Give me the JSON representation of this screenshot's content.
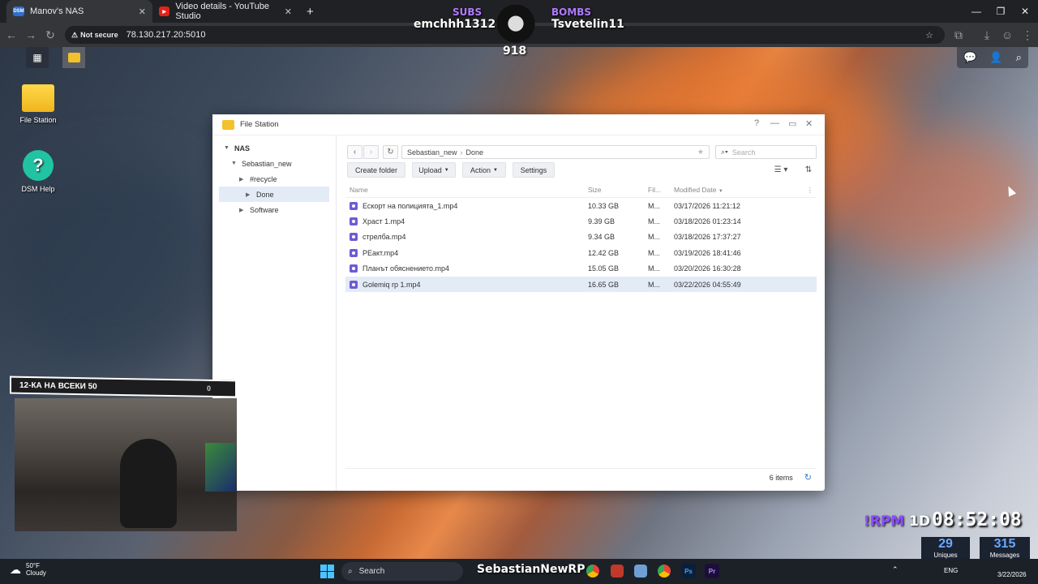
{
  "browser": {
    "tabs": [
      {
        "label": "Manov's NAS",
        "active": true,
        "icon": "dsm-icon"
      },
      {
        "label": "Video details - YouTube Studio",
        "active": false,
        "icon": "youtube-icon"
      }
    ],
    "not_secure": "Not secure",
    "url": "78.130.217.20:5010"
  },
  "overlay": {
    "subs_label": "SUBS",
    "subs_user": "emchhh1312",
    "bombs_label": "BOMBS",
    "bombs_user": "Tsvetelin11",
    "counter": "918",
    "cam_label": "12-КА НА ВСЕКИ 50",
    "cam_counter": "0",
    "rpm": "!RPM",
    "rpm_val": "1D",
    "clock": "08:52:08",
    "uniques_value": "29",
    "uniques_label": "Uniques",
    "messages_value": "315",
    "messages_label": "Messages"
  },
  "desktop": {
    "icons": [
      {
        "label": "File Station",
        "icon": "folder-icon"
      },
      {
        "label": "DSM Help",
        "icon": "help-icon"
      }
    ]
  },
  "window": {
    "title": "File Station",
    "tree": [
      {
        "label": "NAS",
        "level": 0,
        "expanded": true
      },
      {
        "label": "Sebastian_new",
        "level": 1,
        "expanded": true
      },
      {
        "label": "#recycle",
        "level": 2
      },
      {
        "label": "Done",
        "level": 2,
        "selected": true
      },
      {
        "label": "Software",
        "level": 1
      }
    ],
    "path": [
      "Sebastian_new",
      "Done"
    ],
    "search_placeholder": "Search",
    "actions": {
      "create_folder": "Create folder",
      "upload": "Upload",
      "action": "Action",
      "settings": "Settings"
    },
    "columns": {
      "name": "Name",
      "size": "Size",
      "type": "Fil...",
      "modified": "Modified Date"
    },
    "files": [
      {
        "name": "Ескорт на полицията_1.mp4",
        "size": "10.33 GB",
        "type": "M...",
        "modified": "03/17/2026 11:21:12"
      },
      {
        "name": "Храст 1.mp4",
        "size": "9.39 GB",
        "type": "M...",
        "modified": "03/18/2026 01:23:14"
      },
      {
        "name": "стрелба.mp4",
        "size": "9.34 GB",
        "type": "M...",
        "modified": "03/18/2026 17:37:27"
      },
      {
        "name": "РЕакт.mp4",
        "size": "12.42 GB",
        "type": "M...",
        "modified": "03/19/2026 18:41:46"
      },
      {
        "name": "Планът обяснението.mp4",
        "size": "15.05 GB",
        "type": "M...",
        "modified": "03/20/2026 16:30:28"
      },
      {
        "name": "Golemiq rp 1.mp4",
        "size": "16.65 GB",
        "type": "M...",
        "modified": "03/22/2026 04:55:49",
        "selected": true
      }
    ],
    "item_count": "6 items"
  },
  "taskbar": {
    "weather_temp": "50°F",
    "weather_desc": "Cloudy",
    "search": "Search",
    "stream_name": "SebastianNewRP",
    "lang": "ENG",
    "date": "3/22/2026"
  },
  "colors": {
    "accent": "#6f5ad6",
    "selection": "#e3ebf7",
    "taskbar": "#1c2128"
  }
}
